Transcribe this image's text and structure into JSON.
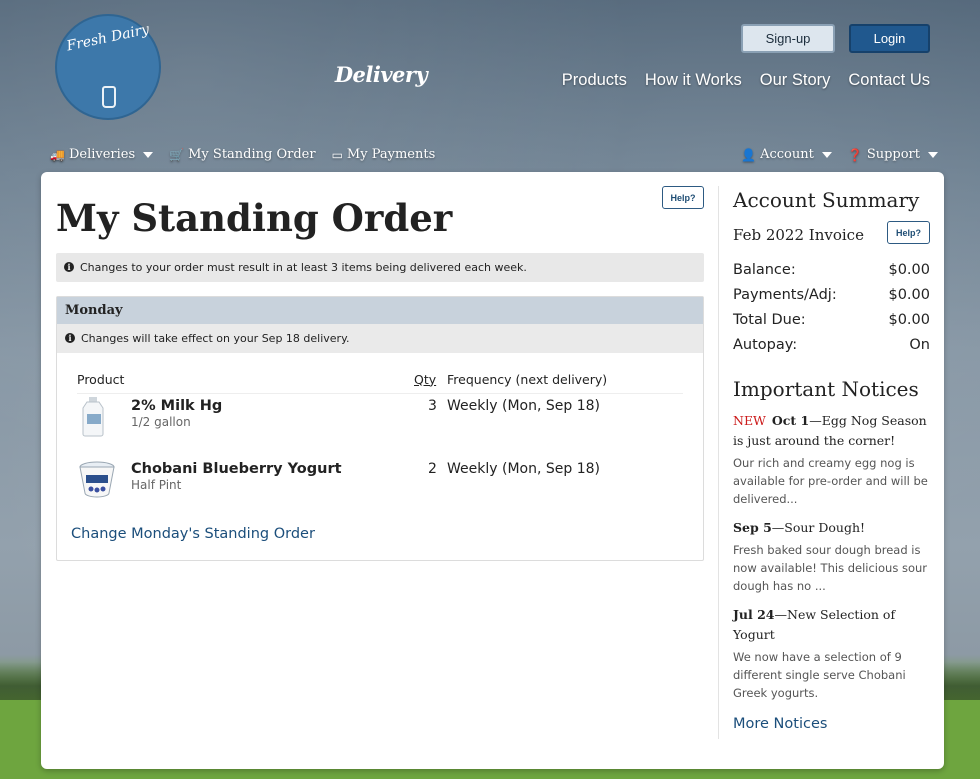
{
  "brand": {
    "logo_top": "Fresh Dairy",
    "logo_main": "Delivery"
  },
  "header": {
    "signup_label": "Sign-up",
    "login_label": "Login",
    "nav": [
      "Products",
      "How it Works",
      "Our Story",
      "Contact Us"
    ]
  },
  "subnav": {
    "deliveries": "Deliveries",
    "standing_order": "My Standing Order",
    "payments": "My Payments",
    "account": "Account",
    "support": "Support"
  },
  "main": {
    "title": "My Standing Order",
    "help_label": "Help?",
    "notice": "Changes to your order must result in at least 3 items being delivered each week.",
    "day": {
      "name": "Monday",
      "notice": "Changes will take effect on your Sep 18 delivery.",
      "columns": {
        "product": "Product",
        "qty": "Qty",
        "frequency": "Frequency (next delivery)"
      },
      "items": [
        {
          "name": "2% Milk Hg",
          "size": "1/2 gallon",
          "qty": "3",
          "frequency": "Weekly (Mon, Sep 18)"
        },
        {
          "name": "Chobani Blueberry Yogurt",
          "size": "Half Pint",
          "qty": "2",
          "frequency": "Weekly (Mon, Sep 18)"
        }
      ],
      "change_link": "Change Monday's Standing Order"
    }
  },
  "sidebar": {
    "summary_title": "Account Summary",
    "invoice": "Feb 2022 Invoice",
    "help_label": "Help?",
    "rows": [
      {
        "label": "Balance:",
        "value": "$0.00"
      },
      {
        "label": "Payments/Adj:",
        "value": "$0.00"
      },
      {
        "label": "Total Due:",
        "value": "$0.00"
      },
      {
        "label": "Autopay:",
        "value": "On"
      }
    ],
    "notices_title": "Important Notices",
    "notices": [
      {
        "new": "NEW",
        "date": "Oct 1",
        "title": "—Egg Nog Season is just around the corner!",
        "body": "Our rich and creamy egg nog is available for pre-order and will be delivered..."
      },
      {
        "new": "",
        "date": "Sep 5",
        "title": "—Sour Dough!",
        "body": "Fresh baked sour dough bread is now available! This delicious sour dough has no ..."
      },
      {
        "new": "",
        "date": "Jul 24",
        "title": "—New Selection of Yogurt",
        "body": "We now have a selection of 9 different single serve Chobani Greek yogurts."
      }
    ],
    "more_link": "More Notices"
  },
  "colors": {
    "accent": "#20588e",
    "link": "#1b4e7b",
    "new_badge": "#cc1b1b",
    "day_header": "#c8d2dc"
  }
}
